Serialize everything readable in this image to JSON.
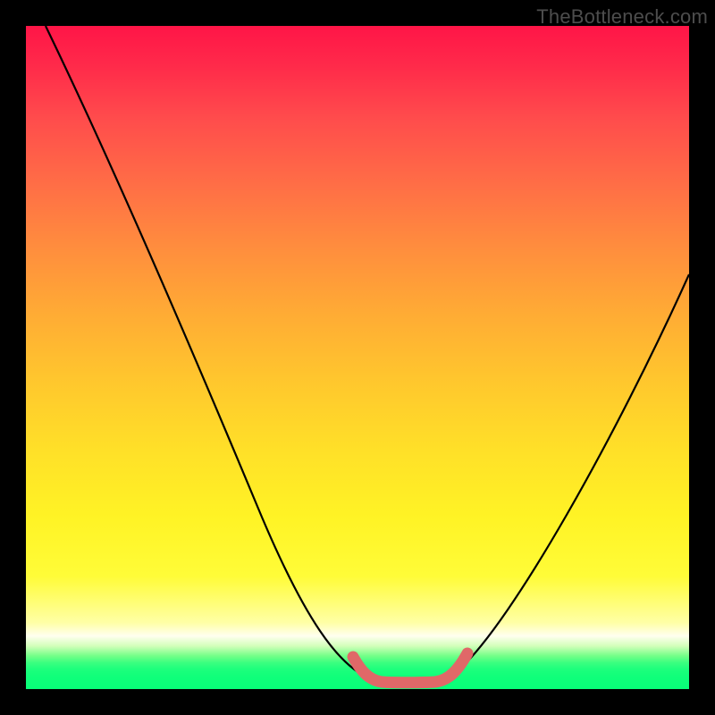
{
  "watermark": "TheBottleneck.com",
  "chart_data": {
    "type": "line",
    "title": "",
    "xlabel": "",
    "ylabel": "",
    "xlim": [
      0,
      100
    ],
    "ylim": [
      0,
      100
    ],
    "grid": false,
    "series": [
      {
        "name": "bottleneck-curve",
        "x": [
          3,
          8,
          14,
          20,
          26,
          32,
          38,
          44,
          49,
          52,
          55,
          58,
          61,
          64,
          70,
          76,
          82,
          88,
          94,
          100
        ],
        "y": [
          100,
          88,
          76,
          64,
          52,
          40,
          28,
          17,
          7,
          2,
          0,
          0,
          0,
          2,
          8,
          18,
          30,
          42,
          53,
          63
        ]
      },
      {
        "name": "marker-band",
        "x": [
          49,
          51,
          53,
          55,
          57,
          59,
          61,
          63,
          65
        ],
        "y": [
          6,
          3,
          1,
          0,
          0,
          0,
          1,
          3,
          6
        ]
      }
    ],
    "colors": {
      "curve": "#000000",
      "marker": "#e06868",
      "gradient_top": "#ff1547",
      "gradient_bottom": "#08ff78",
      "frame": "#000000"
    }
  }
}
